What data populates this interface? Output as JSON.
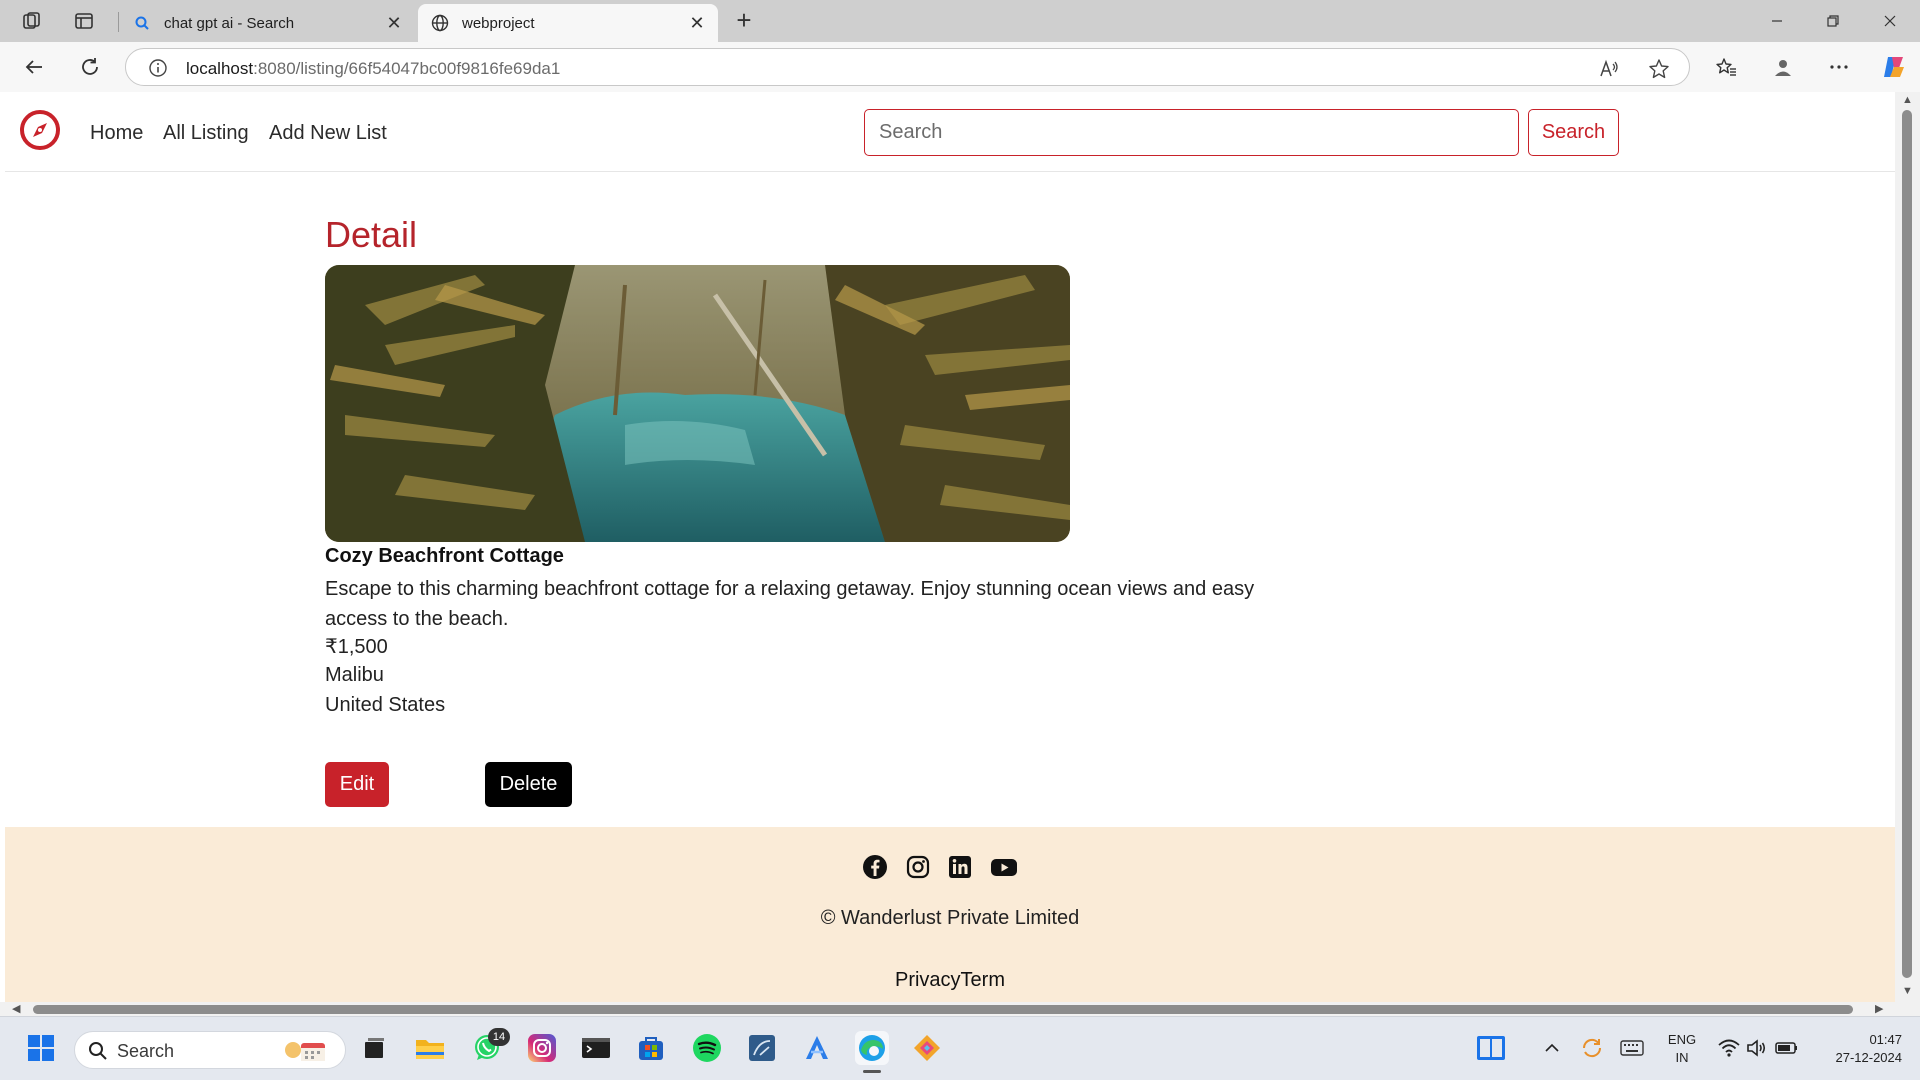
{
  "browser": {
    "tabs": [
      {
        "title": "chat gpt ai - Search",
        "active": false
      },
      {
        "title": "webproject",
        "active": true
      }
    ],
    "url_host": "localhost",
    "url_rest": ":8080/listing/66f54047bc00f9816fe69da1"
  },
  "site": {
    "nav": {
      "home": "Home",
      "all_listing": "All Listing",
      "add_new": "Add New List",
      "search_placeholder": "Search",
      "search_button": "Search"
    },
    "detail_heading": "Detail",
    "listing": {
      "title": "Cozy Beachfront Cottage",
      "description": "Escape to this charming beachfront cottage for a relaxing getaway. Enjoy stunning ocean views and easy access to the beach.",
      "price": "₹1,500",
      "location": "Malibu",
      "country": "United States"
    },
    "actions": {
      "edit": "Edit",
      "delete": "Delete"
    },
    "footer": {
      "social_icons": [
        "facebook-icon",
        "instagram-icon",
        "linkedin-icon",
        "youtube-icon"
      ],
      "copyright": "© Wanderlust Private Limited",
      "legal": "PrivacyTerm"
    },
    "colors": {
      "brand": "#c8222a",
      "footer_bg": "#faebd7"
    }
  },
  "taskbar": {
    "search_label": "Search",
    "whatsapp_badge": "14",
    "lang_line1": "ENG",
    "lang_line2": "IN",
    "time": "01:47",
    "date": "27-12-2024"
  }
}
